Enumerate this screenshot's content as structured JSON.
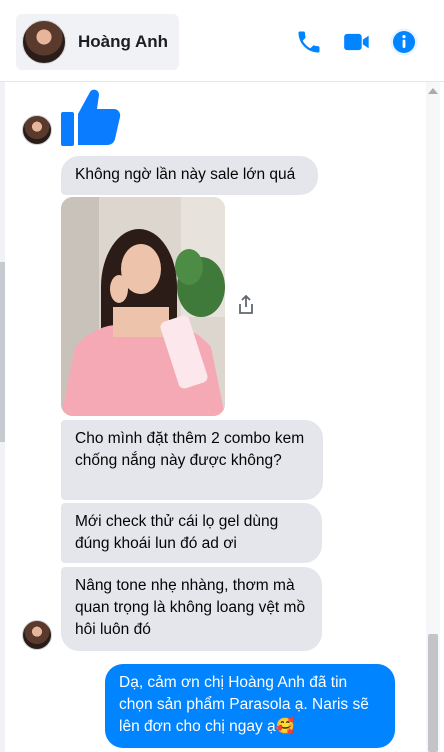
{
  "header": {
    "contact_name": "Hoàng Anh",
    "icons": [
      "phone-icon",
      "video-icon",
      "info-icon"
    ],
    "accent_color": "#0084ff"
  },
  "messages": [
    {
      "from": "contact",
      "type": "sticker",
      "icon": "thumbs-up-icon"
    },
    {
      "from": "contact",
      "type": "text",
      "text": "Không ngờ lần này sale lớn quá"
    },
    {
      "from": "contact",
      "type": "image",
      "icon": "share-icon"
    },
    {
      "from": "contact",
      "type": "text",
      "text": "Cho mình đặt thêm 2 combo kem chống nắng này được không?"
    },
    {
      "from": "contact",
      "type": "text",
      "text": "Mới check thử cái lọ gel dùng đúng khoái lun đó ad ơi"
    },
    {
      "from": "contact",
      "type": "text",
      "text": "Nâng tone nhẹ nhàng, thơm mà quan trọng là không loang vệt mồ hôi luôn đó"
    },
    {
      "from": "me",
      "type": "text",
      "text": "Dạ, cảm ơn chị Hoàng Anh đã tin chọn sản phẩm Parasola ạ. Naris sẽ lên đơn cho chị ngay ạ🥰"
    }
  ]
}
